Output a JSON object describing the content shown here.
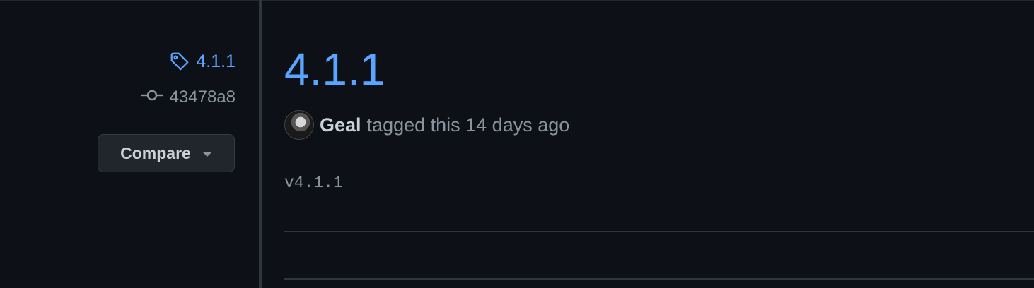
{
  "sidebar": {
    "tag": "4.1.1",
    "commit": "43478a8",
    "compare_label": "Compare"
  },
  "release": {
    "title": "4.1.1",
    "author": "Geal",
    "tagged_text": "tagged this 14 days ago",
    "tag_message": "v4.1.1"
  },
  "icons": {
    "tag": "tag-icon",
    "commit": "git-commit-icon",
    "caret": "caret-down-icon"
  },
  "colors": {
    "background": "#0d1117",
    "link": "#58a6ff",
    "muted": "#8b949e",
    "button_bg": "#21262d"
  }
}
